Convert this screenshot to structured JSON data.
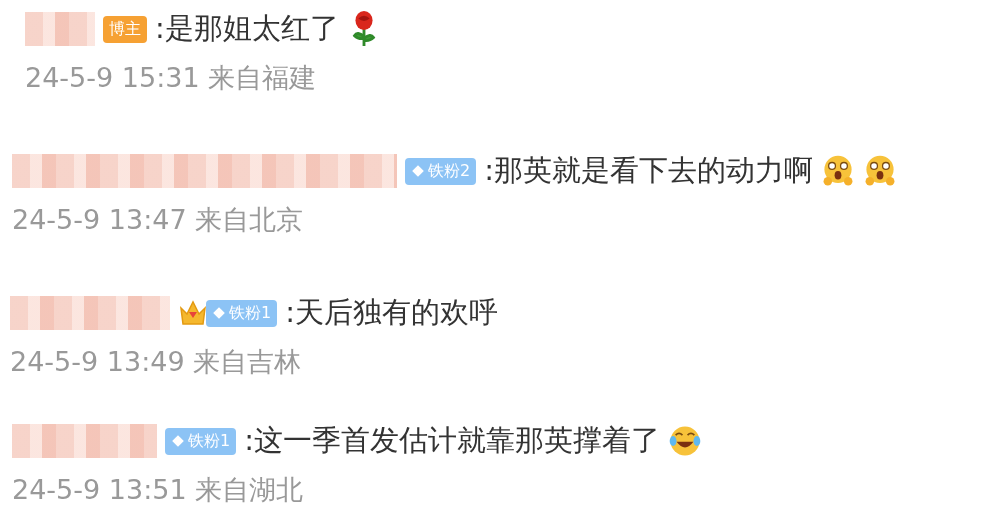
{
  "comments": [
    {
      "crown": false,
      "badge": {
        "kind": "blogger",
        "text": "博主"
      },
      "text": ":是那姐太红了",
      "emojis": [
        {
          "kind": "rose"
        }
      ],
      "time": "24-5-9 15:31 来自福建"
    },
    {
      "crown": false,
      "badge": {
        "kind": "fan",
        "text": "铁粉2"
      },
      "text": ":那英就是看下去的动力啊",
      "emojis": [
        {
          "kind": "wow"
        },
        {
          "kind": "wow"
        }
      ],
      "time": "24-5-9 13:47 来自北京"
    },
    {
      "crown": true,
      "badge": {
        "kind": "fan",
        "text": "铁粉1"
      },
      "text": ":天后独有的欢呼",
      "time": "24-5-9 13:49 来自吉林"
    },
    {
      "crown": false,
      "badge": {
        "kind": "fan",
        "text": "铁粉1"
      },
      "text": ":这一季首发估计就靠那英撑着了",
      "emojis": [
        {
          "kind": "laugh"
        }
      ],
      "time": "24-5-9 13:51 来自湖北"
    }
  ]
}
